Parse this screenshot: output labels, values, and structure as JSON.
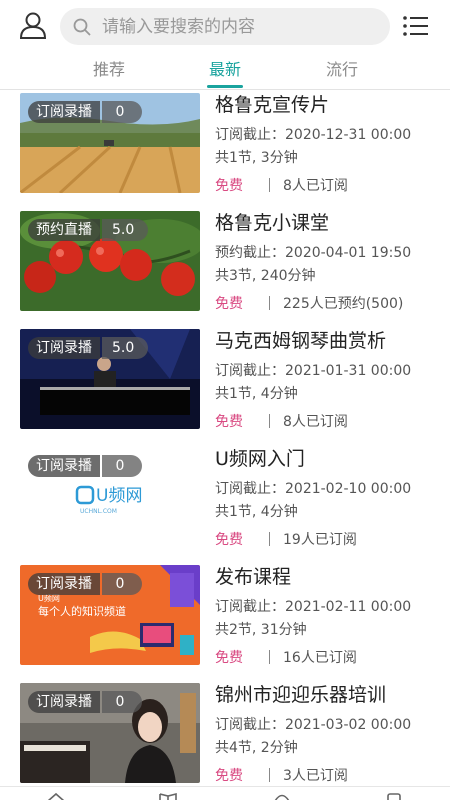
{
  "search": {
    "placeholder": "请输入要搜索的内容"
  },
  "tabs": [
    {
      "label": "推荐"
    },
    {
      "label": "最新"
    },
    {
      "label": "流行"
    }
  ],
  "active_tab": "最新",
  "accent_color": "#1aa39e",
  "price_color": "#d94a82",
  "courses": [
    {
      "title": "格鲁克宣传片",
      "badge_type": "订阅录播",
      "badge_score": "0",
      "deadline": "订阅截止：2020-12-31 00:00",
      "meta": "共1节, 3分钟",
      "price": "免费",
      "count": "8人已订阅"
    },
    {
      "title": "格鲁克小课堂",
      "badge_type": "预约直播",
      "badge_score": "5.0",
      "deadline": "预约截止：2020-04-01 19:50",
      "meta": "共3节, 240分钟",
      "price": "免费",
      "count": "225人已预约(500)"
    },
    {
      "title": "马克西姆钢琴曲赏析",
      "badge_type": "订阅录播",
      "badge_score": "5.0",
      "deadline": "订阅截止：2021-01-31 00:00",
      "meta": "共1节, 4分钟",
      "price": "免费",
      "count": "8人已订阅"
    },
    {
      "title": " U频网入门",
      "badge_type": "订阅录播",
      "badge_score": "0",
      "deadline": "订阅截止：2021-02-10 00:00",
      "meta": "共1节, 4分钟",
      "price": "免费",
      "count": "19人已订阅"
    },
    {
      "title": " 发布课程",
      "badge_type": "订阅录播",
      "badge_score": "0",
      "deadline": "订阅截止：2021-02-11 00:00",
      "meta": "共2节, 31分钟",
      "price": "免费",
      "count": "16人已订阅"
    },
    {
      "title": "锦州市迎迎乐器培训",
      "badge_type": "订阅录播",
      "badge_score": "0",
      "deadline": "订阅截止：2021-03-02 00:00",
      "meta": "共4节, 2分钟",
      "price": "免费",
      "count": "3人已订阅"
    }
  ],
  "thumb_texts": {
    "logo_name": "U频网",
    "logo_url": "UCHNL.COM",
    "banner_brand": "U频网",
    "banner_slogan": "每个人的知识频道"
  }
}
